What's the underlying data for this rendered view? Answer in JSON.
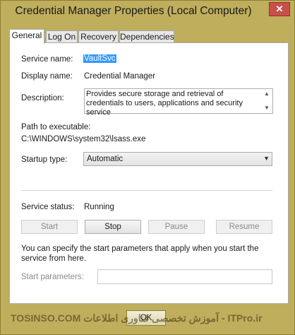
{
  "window": {
    "title": "Credential Manager Properties (Local Computer)",
    "close_glyph": "✕"
  },
  "tabs": [
    {
      "label": "General",
      "active": true
    },
    {
      "label": "Log On",
      "active": false
    },
    {
      "label": "Recovery",
      "active": false
    },
    {
      "label": "Dependencies",
      "active": false
    }
  ],
  "general": {
    "service_name_label": "Service name:",
    "service_name_value": "VaultSvc",
    "display_name_label": "Display name:",
    "display_name_value": "Credential Manager",
    "description_label": "Description:",
    "description_value": "Provides secure storage and retrieval of credentials to users, applications and security service",
    "path_label": "Path to executable:",
    "path_value": "C:\\WINDOWS\\system32\\lsass.exe",
    "startup_type_label": "Startup type:",
    "startup_type_value": "Automatic",
    "service_status_label": "Service status:",
    "service_status_value": "Running",
    "buttons": {
      "start": "Start",
      "stop": "Stop",
      "pause": "Pause",
      "resume": "Resume"
    },
    "info_text": "You can specify the start parameters that apply when you start the service from here.",
    "start_params_label": "Start parameters:",
    "start_params_value": ""
  },
  "footer": {
    "ok": "OK",
    "watermark": "TOSINSO.COM  آموزش تخصصی فناوری اطلاعات - ITPro.ir"
  },
  "icons": {
    "scroll_up": "▲",
    "scroll_down": "▼",
    "select_arrow": "▼"
  },
  "colors": {
    "title_bar": "#bfae5c",
    "selection": "#3399ff",
    "close_button": "#c7504a"
  }
}
